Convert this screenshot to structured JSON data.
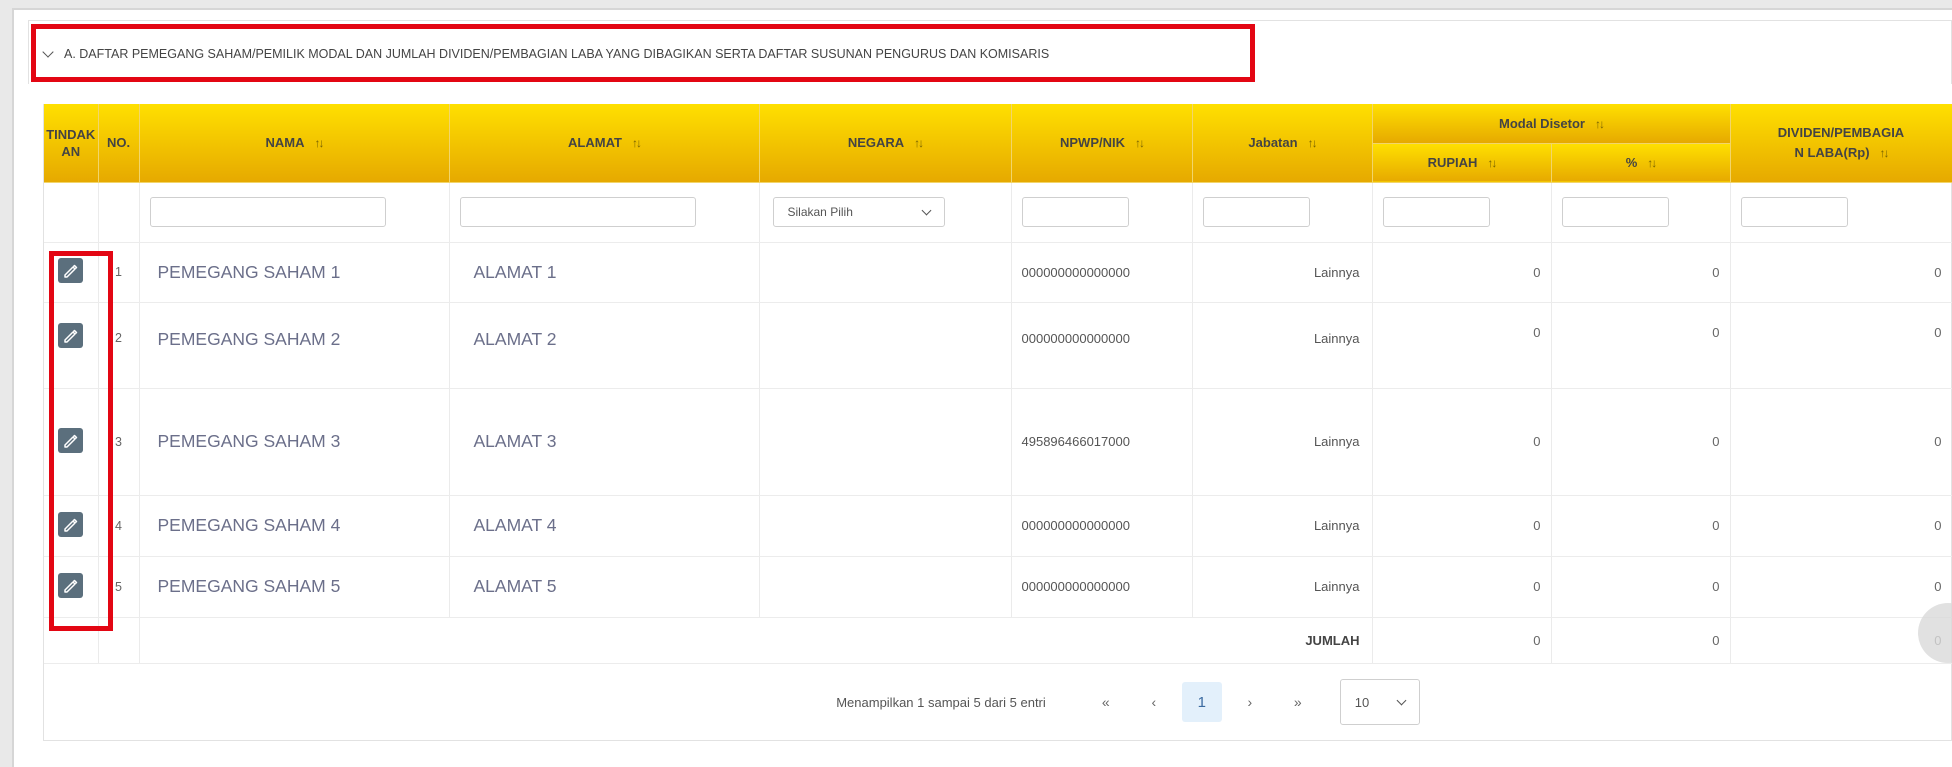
{
  "section": {
    "title": "A. DAFTAR PEMEGANG SAHAM/PEMILIK MODAL DAN JUMLAH DIVIDEN/PEMBAGIAN LABA YANG DIBAGIKAN SERTA DAFTAR SUSUNAN PENGURUS DAN KOMISARIS"
  },
  "table": {
    "headers": {
      "tindakan_1": "TINDAK",
      "tindakan_2": "AN",
      "no": "NO.",
      "nama": "NAMA",
      "alamat": "ALAMAT",
      "negara": "NEGARA",
      "npwp": "NPWP/NIK",
      "jabatan": "Jabatan",
      "modal_disetor": "Modal Disetor",
      "rupiah": "RUPIAH",
      "persen": "%",
      "dividen_1": "DIVIDEN/PEMBAGIA",
      "dividen_2": "N LABA(Rp)",
      "sort_icon": "↑↓"
    },
    "filters": {
      "negara_placeholder": "Silakan Pilih"
    },
    "rows": [
      {
        "no": "1",
        "nama": "PEMEGANG SAHAM 1",
        "alamat": "ALAMAT 1",
        "negara": "",
        "npwp": "000000000000000",
        "jabatan": "Lainnya",
        "rupiah": "0",
        "persen": "0",
        "dividen": "0"
      },
      {
        "no": "2",
        "nama": "PEMEGANG SAHAM 2",
        "alamat": "ALAMAT 2",
        "negara": "",
        "npwp": "000000000000000",
        "jabatan": "Lainnya",
        "rupiah": "0",
        "persen": "0",
        "dividen": "0"
      },
      {
        "no": "3",
        "nama": "PEMEGANG SAHAM 3",
        "alamat": "ALAMAT 3",
        "negara": "",
        "npwp": "495896466017000",
        "jabatan": "Lainnya",
        "rupiah": "0",
        "persen": "0",
        "dividen": "0"
      },
      {
        "no": "4",
        "nama": "PEMEGANG SAHAM 4",
        "alamat": "ALAMAT 4",
        "negara": "",
        "npwp": "000000000000000",
        "jabatan": "Lainnya",
        "rupiah": "0",
        "persen": "0",
        "dividen": "0"
      },
      {
        "no": "5",
        "nama": "PEMEGANG SAHAM 5",
        "alamat": "ALAMAT 5",
        "negara": "",
        "npwp": "000000000000000",
        "jabatan": "Lainnya",
        "rupiah": "0",
        "persen": "0",
        "dividen": "0"
      }
    ],
    "footer": {
      "label": "JUMLAH",
      "rupiah": "0",
      "persen": "0",
      "dividen": "0"
    }
  },
  "pagination": {
    "info": "Menampilkan 1 sampai 5 dari 5 entri",
    "first": "«",
    "prev": "‹",
    "current_page": "1",
    "next": "›",
    "last": "»",
    "page_size": "10"
  },
  "icons": {
    "edit": "edit-pencil-icon",
    "collapse": "chevron-down-icon"
  },
  "colors": {
    "header_gradient_top": "#ffe000",
    "header_gradient_bottom": "#e6a900",
    "highlight": "#e30613",
    "edit_button": "#5b6f7d",
    "active_page": "#e3f0fb"
  }
}
